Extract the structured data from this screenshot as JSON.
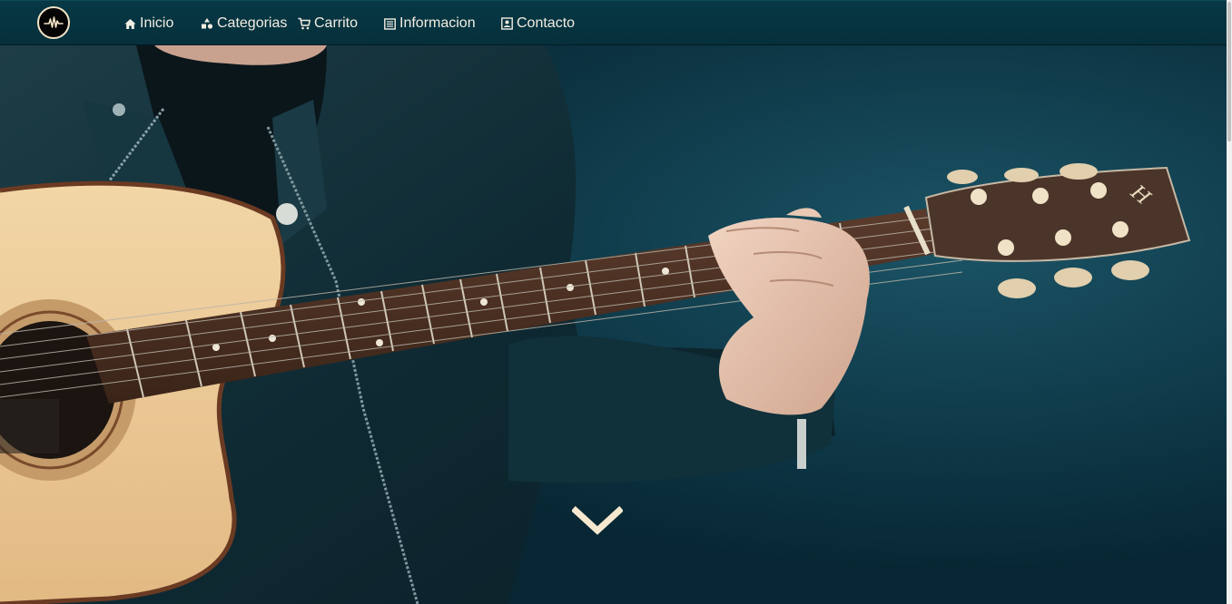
{
  "navbar": {
    "logo_icon": "soundwave-logo-icon",
    "items": [
      {
        "label": "Inicio",
        "icon": "home-icon"
      },
      {
        "label": "Categorias",
        "icon": "shapes-icon"
      },
      {
        "label": "Carrito",
        "icon": "cart-icon"
      },
      {
        "label": "Informacion",
        "icon": "document-icon"
      },
      {
        "label": "Contacto",
        "icon": "contact-card-icon"
      }
    ]
  },
  "hero": {
    "image": "guitarist-playing-acoustic-guitar",
    "scroll_icon": "chevron-down-icon"
  },
  "colors": {
    "navbar_bg": "#06303b",
    "nav_text": "#f3eee3",
    "accent_cream": "#f6e8cf",
    "hero_bg": "#0d3544"
  }
}
